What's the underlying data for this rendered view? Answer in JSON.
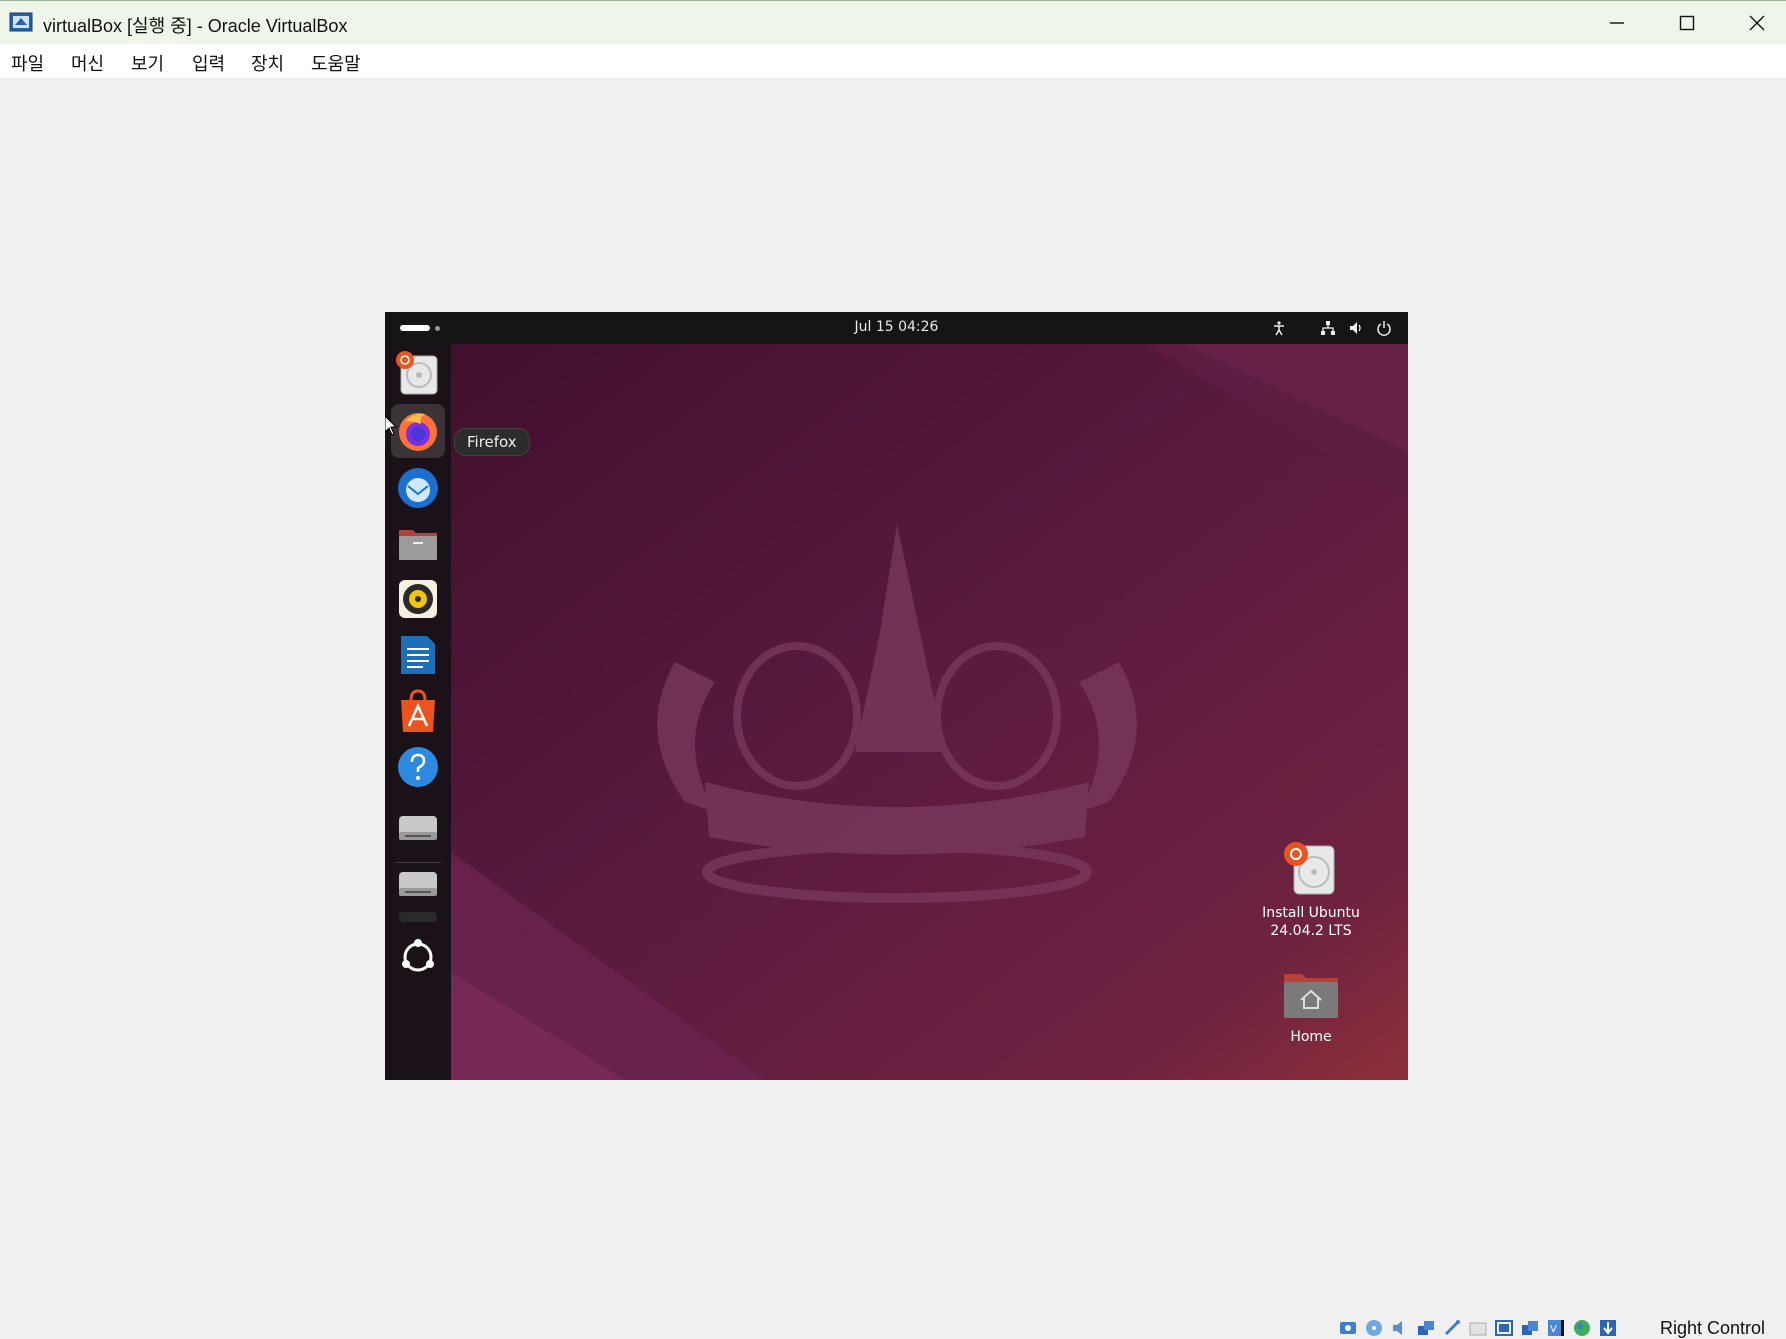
{
  "window": {
    "title": "virtualBox [실행 중] - Oracle VirtualBox"
  },
  "menu": [
    "파일",
    "머신",
    "보기",
    "입력",
    "장치",
    "도움말"
  ],
  "guest": {
    "clock": "Jul 15  04:26",
    "tooltip": "Firefox",
    "dock_items": [
      {
        "name": "Install Ubuntu",
        "icon": "installer-icon"
      },
      {
        "name": "Firefox",
        "icon": "firefox-icon"
      },
      {
        "name": "Thunderbird",
        "icon": "thunderbird-icon"
      },
      {
        "name": "Files",
        "icon": "files-icon"
      },
      {
        "name": "Rhythmbox",
        "icon": "rhythmbox-icon"
      },
      {
        "name": "LibreOffice Writer",
        "icon": "writer-icon"
      },
      {
        "name": "App Center",
        "icon": "app-center-icon"
      },
      {
        "name": "Help",
        "icon": "help-icon"
      },
      {
        "name": "Drive 1",
        "icon": "drive-icon"
      },
      {
        "name": "Drive 2",
        "icon": "drive-icon"
      },
      {
        "name": "Drive 3",
        "icon": "drive-icon"
      },
      {
        "name": "Show Apps",
        "icon": "ubuntu-apps-icon"
      }
    ],
    "desktop_icons": [
      {
        "label": "Install Ubuntu 24.04.2 LTS",
        "icon": "installer-icon"
      },
      {
        "label": "Home",
        "icon": "home-folder-icon"
      }
    ]
  },
  "statusbar": {
    "host_key": "Right Control"
  }
}
